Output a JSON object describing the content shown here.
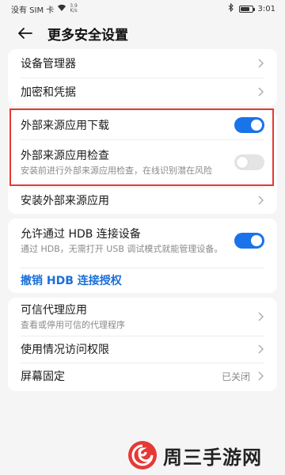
{
  "status": {
    "carrier": "没有 SIM 卡",
    "speed_value": "3.9",
    "speed_unit": "K/s",
    "time": "3:01",
    "battery_level": 0.85
  },
  "header": {
    "title": "更多安全设置"
  },
  "section1": {
    "device_admin": "设备管理器",
    "encryption": "加密和凭据"
  },
  "section2": {
    "external_download": {
      "label": "外部来源应用下载",
      "enabled": true
    },
    "external_check": {
      "label": "外部来源应用检查",
      "desc": "安装前进行外部来源应用检查，在线识别潜在风险",
      "enabled": false
    },
    "install_external": "安装外部来源应用"
  },
  "section3": {
    "hdb": {
      "label": "允许通过 HDB 连接设备",
      "desc": "通过 HDB，无需打开 USB 调试模式就能管理设备。",
      "enabled": true
    },
    "revoke": "撤销 HDB 连接授权"
  },
  "section4": {
    "trust_agents": {
      "label": "可信代理应用",
      "desc": "查看或停用可信的代理程序"
    },
    "usage_access": "使用情况访问权限",
    "screen_pin": {
      "label": "屏幕固定",
      "value": "已关闭"
    }
  },
  "watermark": "周三手游网",
  "colors": {
    "accent": "#1a73e8",
    "highlight": "#e53935",
    "link": "#1a6fd8"
  }
}
